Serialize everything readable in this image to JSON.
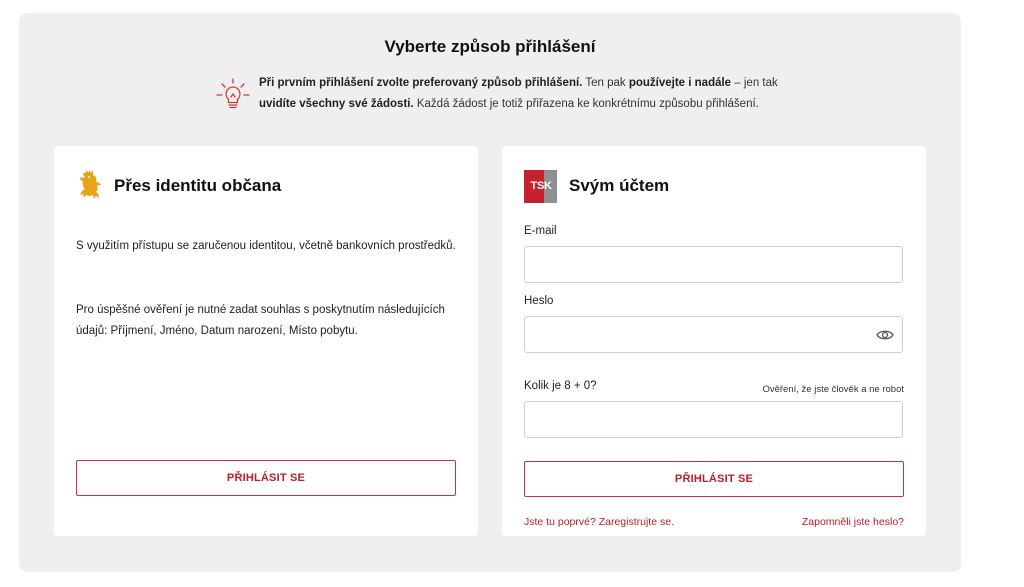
{
  "page": {
    "title": "Vyberte způsob přihlášení",
    "info": {
      "icon": "lightbulb-icon",
      "bold1": "Při prvním přihlášení zvolte preferovaný způsob přihlášení.",
      "text1": " Ten pak ",
      "bold2": "používejte i nadále",
      "text2": " – jen tak ",
      "bold3": "uvidíte všechny své žádosti.",
      "text3": " Každá žádost je totiž přiřazena ke konkrétnímu způsobu přihlášení."
    }
  },
  "identity": {
    "icon": "czech-lion-icon",
    "title": "Přes identitu občana",
    "para1": "S využitím přístupu se zaručenou identitou, včetně bankovních prostředků.",
    "para2": "Pro úspěšné ověření je nutné zadat souhlas s poskytnutím následujících údajů: Příjmení, Jméno, Datum narození, Místo pobytu.",
    "button": "PŘIHLÁSIT SE"
  },
  "account": {
    "logo_text_red": "TS",
    "logo_text_grey": "K",
    "title": "Svým účtem",
    "email_label": "E-mail",
    "email_value": "",
    "password_label": "Heslo",
    "password_value": "",
    "eye_icon": "eye-icon",
    "captcha_label": "Kolik je 8 + 0?",
    "captcha_hint": "Ověření, že jste člověk a ne robot",
    "captcha_value": "",
    "button": "PŘIHLÁSIT SE",
    "register_link": "Jste tu poprvé? Zaregistrujte se.",
    "forgot_link": "Zapomněli jste heslo?"
  },
  "colors": {
    "accent": "#b5202b",
    "panel": "#efefef",
    "logo_red": "#c8202e",
    "logo_grey": "#8d8f93",
    "lion_gold": "#e8a317"
  }
}
